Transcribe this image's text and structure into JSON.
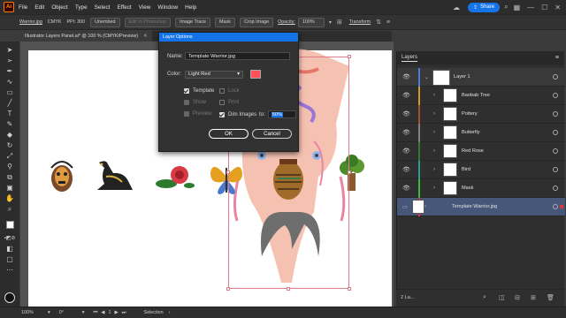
{
  "app": {
    "logo": "Ai"
  },
  "menu": [
    "File",
    "Edit",
    "Object",
    "Type",
    "Select",
    "Effect",
    "View",
    "Window",
    "Help"
  ],
  "topright": {
    "share_label": "Share"
  },
  "control_bar": {
    "doc_name": "Warrior.jpg",
    "color_mode": "CMYK",
    "ppi": "PPI: 300",
    "unembed": "Unembed",
    "edit_photoshop": "Edit In Photoshop",
    "image_trace": "Image Trace",
    "mask": "Mask",
    "crop_image": "Crop Image",
    "opacity_label": "Opacity:",
    "opacity_value": "100%",
    "transform": "Transform"
  },
  "document_tab": {
    "title": "Illustrator Layers Panel.ai* @ 100 % (CMYK/Preview)"
  },
  "dialog": {
    "title": "Layer Options",
    "name_label": "Name:",
    "name_value": "Template Warrior.jpg",
    "color_label": "Color:",
    "color_value": "Light Red",
    "template_label": "Template",
    "lock_label": "Lock",
    "show_label": "Show",
    "print_label": "Print",
    "preview_label": "Preview",
    "dim_label": "Dim Images",
    "dim_to": "to:",
    "dim_value": "50%",
    "ok_label": "OK",
    "cancel_label": "Cancel",
    "swatch_color": "#ff4f5a"
  },
  "layers_panel": {
    "title": "Layers",
    "layers": [
      {
        "name": "Layer 1",
        "color": "#4a7bd6"
      },
      {
        "name": "Baobab Tree",
        "color": "#d09a2a"
      },
      {
        "name": "Pottery",
        "color": "#a0522d"
      },
      {
        "name": "Butterfly",
        "color": "#808080"
      },
      {
        "name": "Red Rose",
        "color": "#2f7a2f"
      },
      {
        "name": "Bird",
        "color": "#2e9d8e"
      },
      {
        "name": "Mask",
        "color": "#3fb83f"
      },
      {
        "name": "Template Warrior.jpg",
        "color": "#e3343a"
      }
    ],
    "footer_count": "2 La..."
  },
  "status_bar": {
    "zoom": "100%",
    "rotation": "0°",
    "artboard": "1",
    "tool": "Selection"
  }
}
